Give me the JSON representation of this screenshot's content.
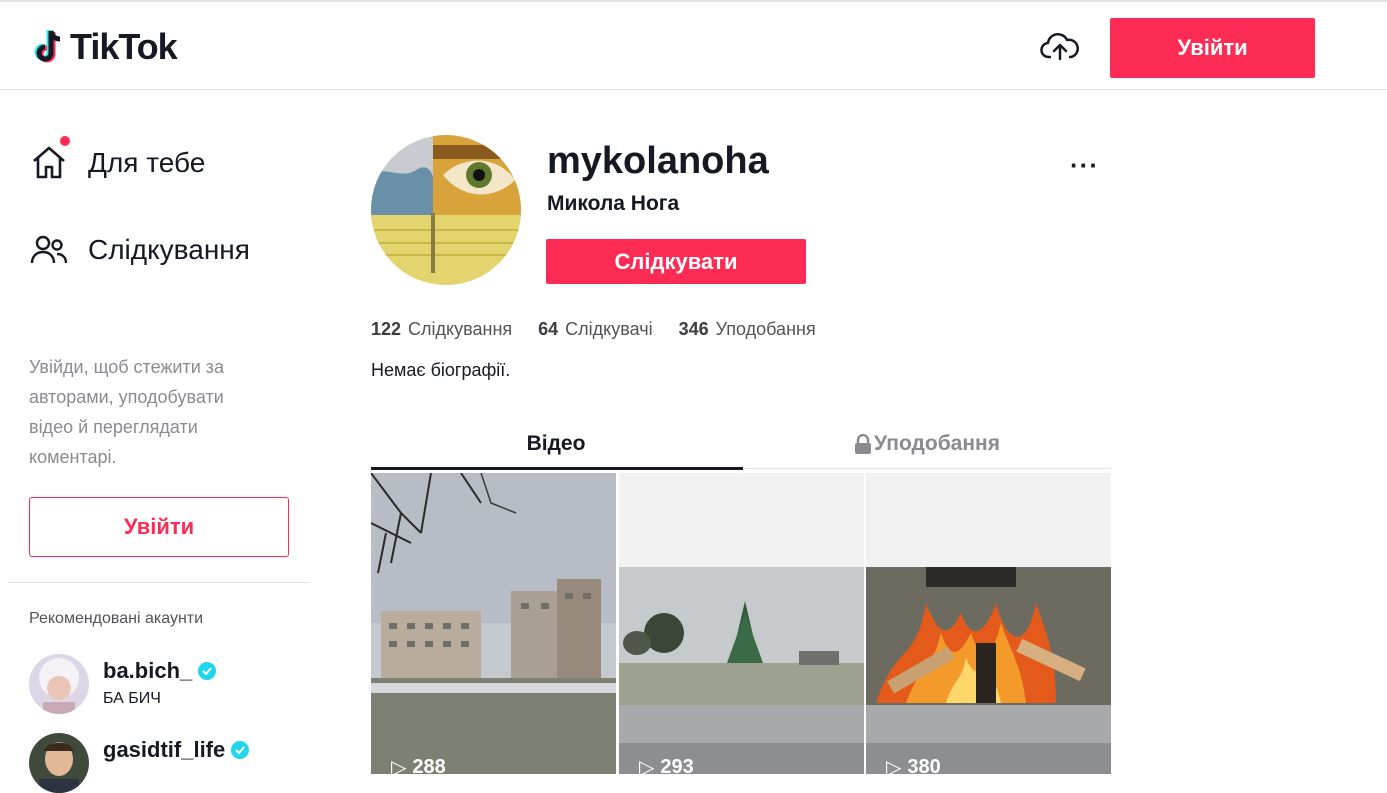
{
  "header": {
    "logo_text": "TikTok",
    "login_label": "Увійти",
    "upload_icon": "cloud-upload-icon",
    "accent_color": "#fe2c55"
  },
  "sidebar": {
    "items": [
      {
        "label": "Для тебе",
        "icon": "home-icon"
      },
      {
        "label": "Слідкування",
        "icon": "people-icon"
      }
    ],
    "login_hint": "Увійди, щоб стежити за авторами, уподобувати відео й переглядати коментарі.",
    "login_label": "Увійти",
    "recommended_title": "Рекомендовані акаунти",
    "recommended": [
      {
        "username": "ba.bich_",
        "name": "БА БИЧ",
        "verified": true
      },
      {
        "username": "gasidtif_life",
        "name": "",
        "verified": true
      }
    ]
  },
  "profile": {
    "username": "mykolanoha",
    "display_name": "Микола Нога",
    "follow_label": "Слідкувати",
    "more_label": "···",
    "stats": [
      {
        "value": "122",
        "label": "Слідкування"
      },
      {
        "value": "64",
        "label": "Слідкувачі"
      },
      {
        "value": "346",
        "label": "Уподобання"
      }
    ],
    "bio": "Немає біографії."
  },
  "tabs": {
    "videos": "Відео",
    "likes": "Уподобання"
  },
  "videos": [
    {
      "views": "288",
      "scene": "winter city street with apartment blocks"
    },
    {
      "views": "293",
      "scene": "town square with christmas tree"
    },
    {
      "views": "380",
      "scene": "campfire in snow"
    }
  ]
}
